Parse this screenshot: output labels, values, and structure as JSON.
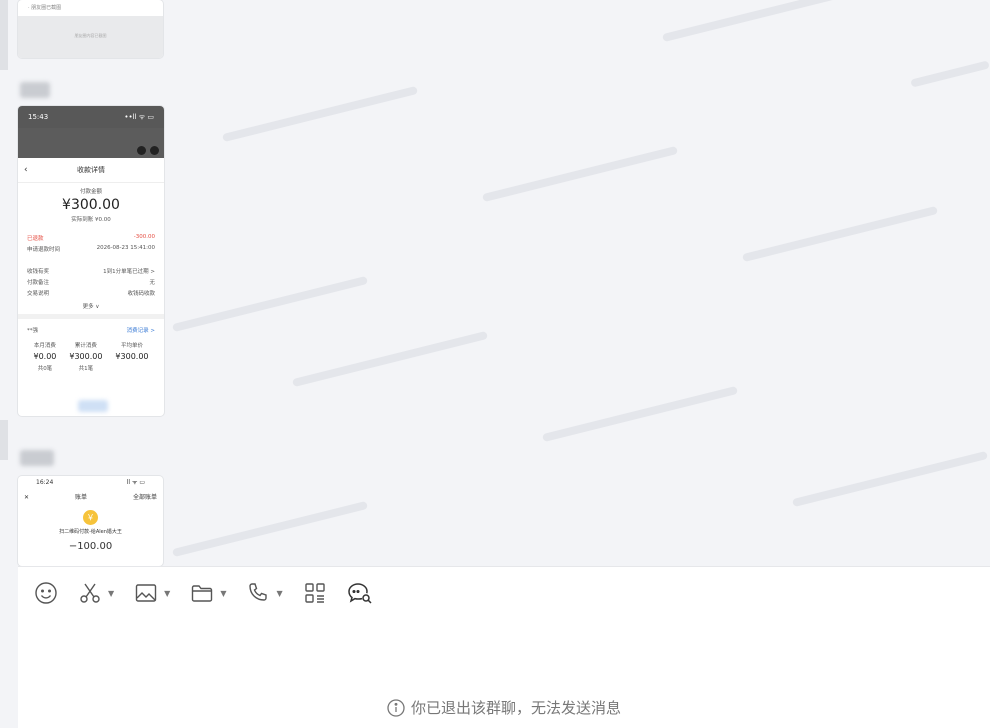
{
  "images": {
    "first": {
      "caption": "· 朋友圈已截图",
      "body_text": "朋友圈内容已截图"
    },
    "receipt": {
      "time": "15:43",
      "status_icons": "••ll ᯤ ▭",
      "nav_title": "收款详情",
      "amount_label": "付款金额",
      "amount": "¥300.00",
      "received_label": "实际到账",
      "received_value": "¥0.00",
      "refunded_label": "已退款",
      "refunded_value": "-300.00",
      "refund_time_label": "申请退款时间",
      "refund_time_value": "2026-08-23 15:41:00",
      "rows": [
        {
          "label": "收钱有奖",
          "value": "1到1分单笔已过期 >"
        },
        {
          "label": "付款备注",
          "value": "无"
        },
        {
          "label": "交易说明",
          "value": "收钱码收款"
        }
      ],
      "more": "更多 ∨",
      "payer": "**强",
      "payer_link": "消费记录 >",
      "stats": [
        {
          "label": "本月消费",
          "value": "¥0.00",
          "sub": "共0笔"
        },
        {
          "label": "累计消费",
          "value": "¥300.00",
          "sub": "共1笔"
        },
        {
          "label": "平均单价",
          "value": "¥300.00",
          "sub": ""
        }
      ]
    },
    "bill": {
      "time": "16:24",
      "status_icons": "ll ᯤ ▭",
      "close": "✕",
      "title": "账单",
      "all": "全部账单",
      "coin": "￥",
      "merchant": "扫二维码付款-给Alen婚大王",
      "amount": "−100.00"
    }
  },
  "toolbar": {
    "items": [
      {
        "icon": "emoji-icon",
        "caret": false
      },
      {
        "icon": "scissors-icon",
        "caret": true
      },
      {
        "icon": "image-icon",
        "caret": true
      },
      {
        "icon": "folder-icon",
        "caret": true
      },
      {
        "icon": "phone-icon",
        "caret": true
      },
      {
        "icon": "apps-icon",
        "caret": false
      },
      {
        "icon": "chat-search-icon",
        "caret": false
      }
    ]
  },
  "notice": {
    "icon": "info-icon",
    "text": "你已退出该群聊，无法发送消息"
  }
}
